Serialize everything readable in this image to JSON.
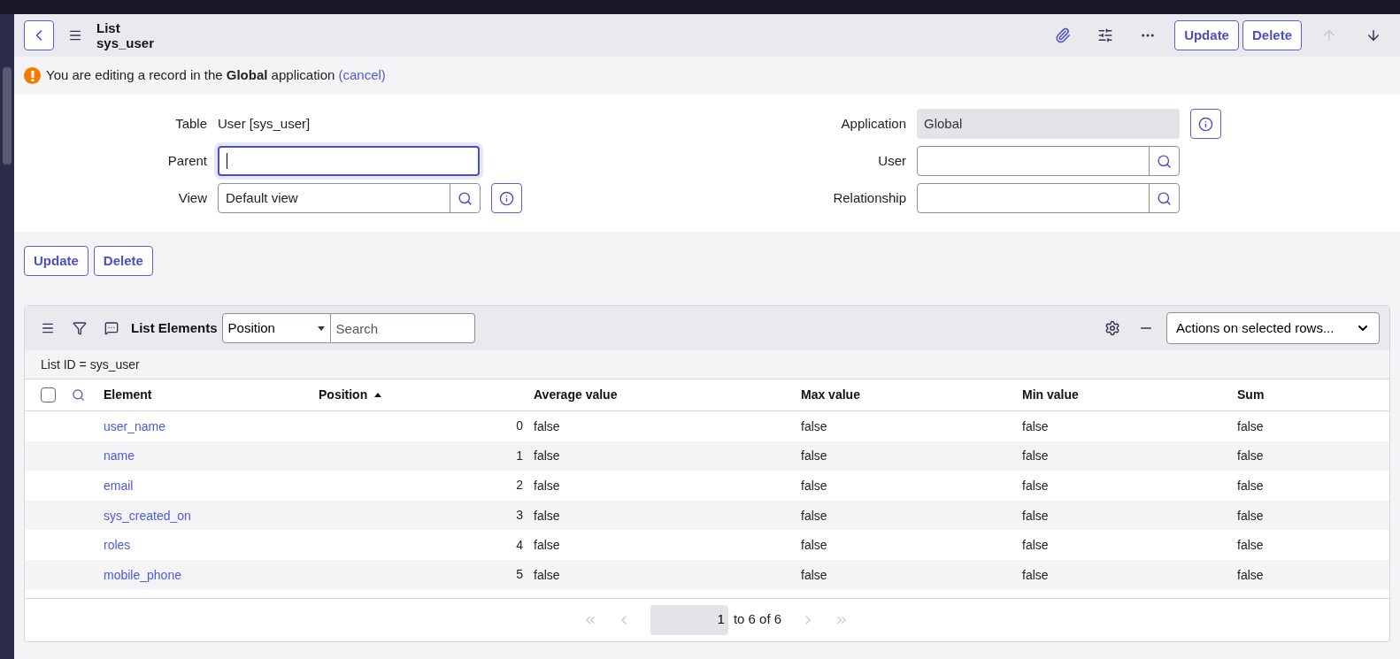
{
  "header": {
    "title": "List",
    "subtitle": "sys_user",
    "buttons": [
      "Update",
      "Delete"
    ],
    "nav": [
      {
        "kind": "up",
        "disabled": true
      },
      {
        "kind": "down",
        "disabled": false
      }
    ]
  },
  "banner": {
    "message": "You are editing a record in the **Global** application",
    "link": "(cancel)"
  },
  "form": {
    "left": [
      {
        "kind": "text",
        "label": "Table",
        "value": "User [sys_user]"
      },
      {
        "kind": "input",
        "label": "Parent",
        "focused": true
      },
      {
        "kind": "lookup",
        "label": "View",
        "value": "Default view",
        "info": true
      }
    ],
    "right": [
      {
        "kind": "readonly",
        "label": "Application",
        "value": "Global",
        "info": true
      },
      {
        "kind": "lookup",
        "label": "User"
      },
      {
        "kind": "lookup",
        "label": "Relationship"
      }
    ]
  },
  "buttons": [
    "Update",
    "Delete"
  ],
  "list": {
    "title": "List Elements",
    "search_by": "Position",
    "search_placeholder": "Search",
    "actions": "Actions on selected rows...",
    "breadcrumb": "List ID = sys_user",
    "select_all_checked": false,
    "columns": [
      {
        "label": "Element",
        "sorted": false
      },
      {
        "label": "Position",
        "sorted": true
      },
      {
        "label": "Average value",
        "sorted": false
      },
      {
        "label": "Max value",
        "sorted": false
      },
      {
        "label": "Min value",
        "sorted": false
      },
      {
        "label": "Sum",
        "sorted": false
      }
    ],
    "rows": [
      [
        "user_name",
        "0",
        "false",
        "false",
        "false",
        "false"
      ],
      [
        "name",
        "1",
        "false",
        "false",
        "false",
        "false"
      ],
      [
        "email",
        "2",
        "false",
        "false",
        "false",
        "false"
      ],
      [
        "sys_created_on",
        "3",
        "false",
        "false",
        "false",
        "false"
      ],
      [
        "roles",
        "4",
        "false",
        "false",
        "false",
        "false"
      ],
      [
        "mobile_phone",
        "5",
        "false",
        "false",
        "false",
        "false"
      ]
    ],
    "pagination": {
      "page": "1",
      "range": "to 6 of 6",
      "first_disabled": true,
      "last_disabled": true
    }
  }
}
